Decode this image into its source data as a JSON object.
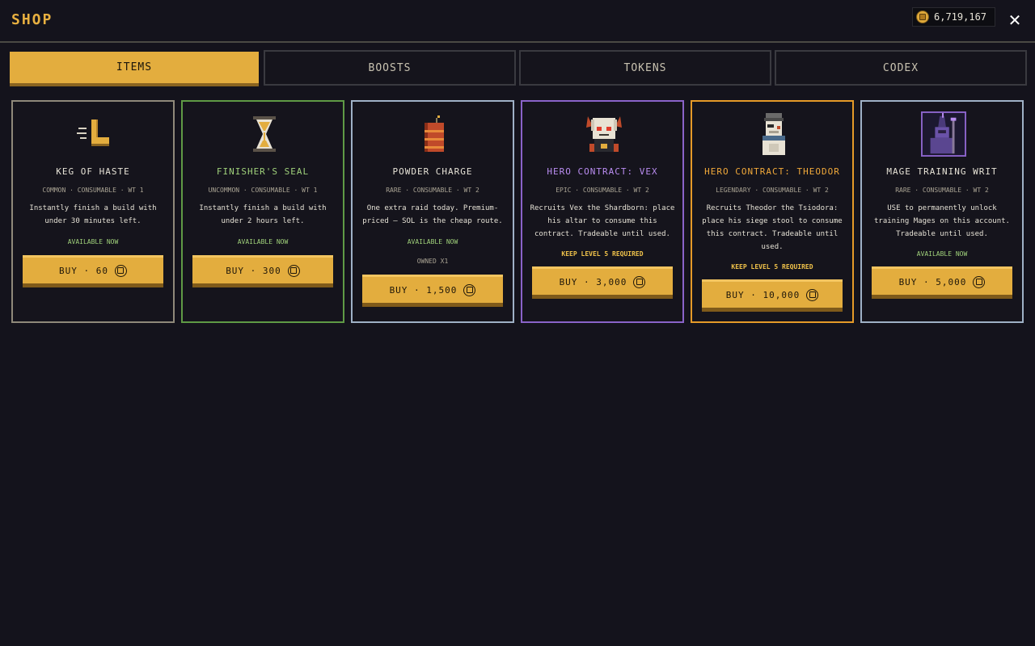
{
  "header": {
    "title": "SHOP",
    "balance": "6,719,167",
    "close_label": "✕"
  },
  "tabs": [
    {
      "label": "ITEMS",
      "active": true
    },
    {
      "label": "BOOSTS",
      "active": false
    },
    {
      "label": "TOKENS",
      "active": false
    },
    {
      "label": "CODEX",
      "active": false
    }
  ],
  "cards": [
    {
      "name": "KEG OF HASTE",
      "meta": "COMMON · CONSUMABLE · WT 1",
      "desc": "Instantly finish a build with under 30 minutes left.",
      "status": "AVAILABLE NOW",
      "buy_label": "BUY · 60",
      "icon": "haste-boot-icon"
    },
    {
      "name": "FINISHER'S SEAL",
      "meta": "UNCOMMON · CONSUMABLE · WT 1",
      "desc": "Instantly finish a build with under 2 hours left.",
      "status": "AVAILABLE NOW",
      "buy_label": "BUY · 300",
      "icon": "hourglass-icon"
    },
    {
      "name": "POWDER CHARGE",
      "meta": "RARE · CONSUMABLE · WT 2",
      "desc": "One extra raid today. Premium-priced — SOL is the cheap route.",
      "status": "AVAILABLE NOW",
      "owned": "OWNED X1",
      "buy_label": "BUY · 1,500",
      "icon": "powder-keg-icon"
    },
    {
      "name": "HERO CONTRACT: VEX",
      "meta": "EPIC · CONSUMABLE · WT 2",
      "desc": "Recruits Vex the Shardborn: place his altar to consume this contract. Tradeable until used.",
      "requirement": "KEEP LEVEL 5 REQUIRED",
      "buy_label": "BUY · 3,000",
      "icon": "vex-portrait-icon"
    },
    {
      "name": "HERO CONTRACT: THEODOR",
      "meta": "LEGENDARY · CONSUMABLE · WT 2",
      "desc": "Recruits Theodor the Tsiodora: place his siege stool to consume this contract. Tradeable until used.",
      "requirement": "KEEP LEVEL 5 REQUIRED",
      "buy_label": "BUY · 10,000",
      "icon": "theodor-portrait-icon"
    },
    {
      "name": "MAGE TRAINING WRIT",
      "meta": "RARE · CONSUMABLE · WT 2",
      "desc": "USE to permanently unlock training Mages on this account. Tradeable until used.",
      "status": "AVAILABLE NOW",
      "buy_label": "BUY · 5,000",
      "icon": "mage-portrait-icon"
    }
  ],
  "colors": {
    "accent": "#e3ad3e",
    "background": "#14131c",
    "common": "#8f897a",
    "uncommon": "#5f9a45",
    "rare": "#9fb1c6",
    "epic": "#8a63c9",
    "legendary": "#e59a28",
    "available": "#9fd07a"
  }
}
